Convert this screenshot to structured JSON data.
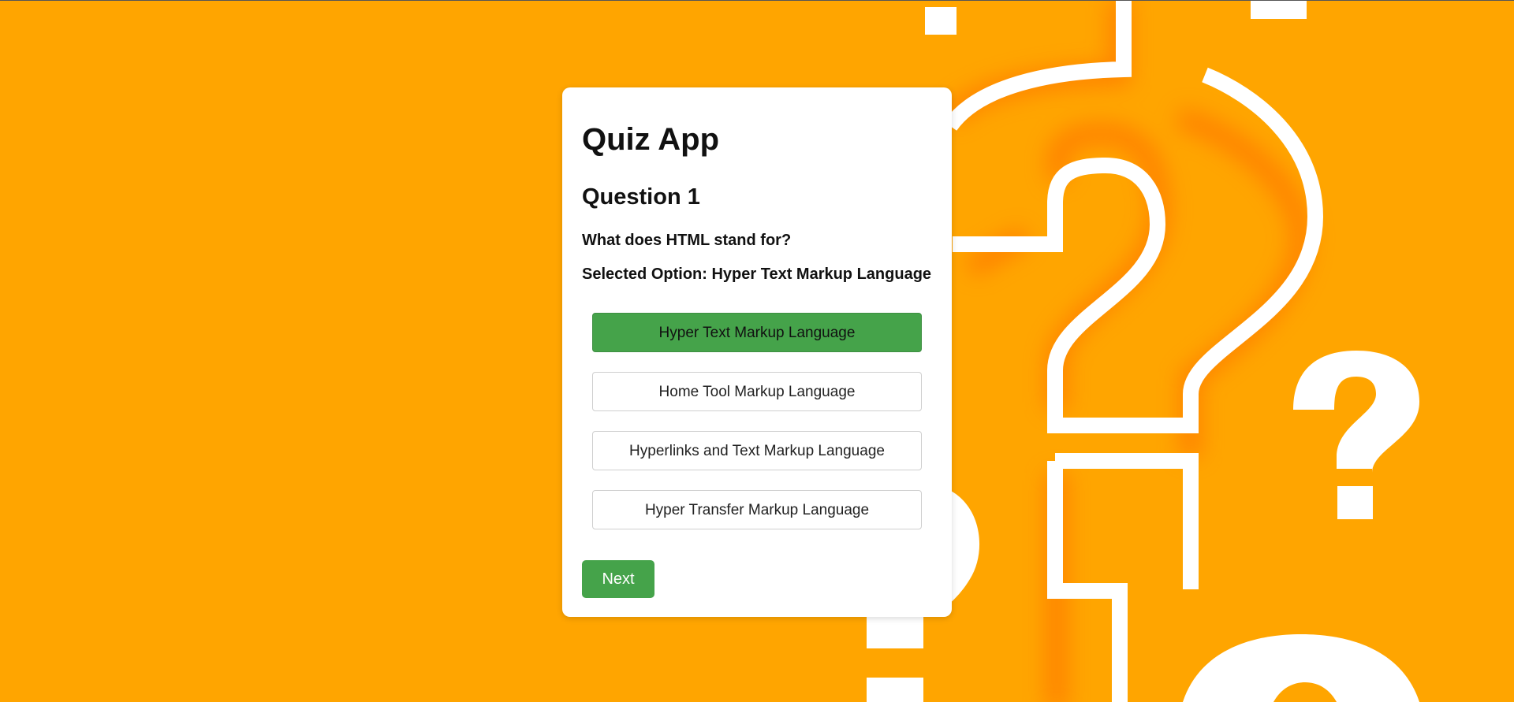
{
  "app": {
    "title": "Quiz App"
  },
  "question": {
    "heading": "Question 1",
    "text": "What does HTML stand for?"
  },
  "selection": {
    "line": "Selected Option: Hyper Text Markup Language"
  },
  "options": [
    {
      "label": "Hyper Text Markup Language",
      "selected": true
    },
    {
      "label": "Home Tool Markup Language",
      "selected": false
    },
    {
      "label": "Hyperlinks and Text Markup Language",
      "selected": false
    },
    {
      "label": "Hyper Transfer Markup Language",
      "selected": false
    }
  ],
  "actions": {
    "next_label": "Next"
  },
  "colors": {
    "background": "#FFA500",
    "accent_green": "#45A34A",
    "card": "#FFFFFF"
  },
  "decor": {
    "background_icon": "question-mark-icon"
  }
}
